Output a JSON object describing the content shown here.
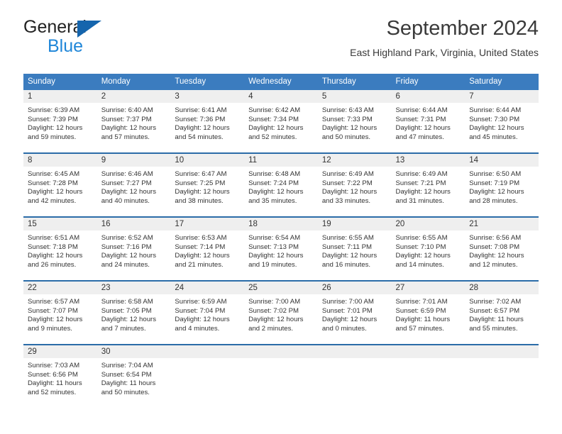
{
  "brand": {
    "line1": "General",
    "line2": "Blue",
    "triangle_color": "#1565ad",
    "blue_text_color": "#1f86d8"
  },
  "header": {
    "title": "September 2024",
    "subtitle": "East Highland Park, Virginia, United States"
  },
  "colors": {
    "header_band": "#3b7cbf",
    "row_divider": "#2b6ca8",
    "daynum_band": "#efefef",
    "text": "#333333"
  },
  "weekday_headers": [
    "Sunday",
    "Monday",
    "Tuesday",
    "Wednesday",
    "Thursday",
    "Friday",
    "Saturday"
  ],
  "weeks": [
    [
      {
        "day": "1",
        "sunrise": "Sunrise: 6:39 AM",
        "sunset": "Sunset: 7:39 PM",
        "daylight1": "Daylight: 12 hours",
        "daylight2": "and 59 minutes."
      },
      {
        "day": "2",
        "sunrise": "Sunrise: 6:40 AM",
        "sunset": "Sunset: 7:37 PM",
        "daylight1": "Daylight: 12 hours",
        "daylight2": "and 57 minutes."
      },
      {
        "day": "3",
        "sunrise": "Sunrise: 6:41 AM",
        "sunset": "Sunset: 7:36 PM",
        "daylight1": "Daylight: 12 hours",
        "daylight2": "and 54 minutes."
      },
      {
        "day": "4",
        "sunrise": "Sunrise: 6:42 AM",
        "sunset": "Sunset: 7:34 PM",
        "daylight1": "Daylight: 12 hours",
        "daylight2": "and 52 minutes."
      },
      {
        "day": "5",
        "sunrise": "Sunrise: 6:43 AM",
        "sunset": "Sunset: 7:33 PM",
        "daylight1": "Daylight: 12 hours",
        "daylight2": "and 50 minutes."
      },
      {
        "day": "6",
        "sunrise": "Sunrise: 6:44 AM",
        "sunset": "Sunset: 7:31 PM",
        "daylight1": "Daylight: 12 hours",
        "daylight2": "and 47 minutes."
      },
      {
        "day": "7",
        "sunrise": "Sunrise: 6:44 AM",
        "sunset": "Sunset: 7:30 PM",
        "daylight1": "Daylight: 12 hours",
        "daylight2": "and 45 minutes."
      }
    ],
    [
      {
        "day": "8",
        "sunrise": "Sunrise: 6:45 AM",
        "sunset": "Sunset: 7:28 PM",
        "daylight1": "Daylight: 12 hours",
        "daylight2": "and 42 minutes."
      },
      {
        "day": "9",
        "sunrise": "Sunrise: 6:46 AM",
        "sunset": "Sunset: 7:27 PM",
        "daylight1": "Daylight: 12 hours",
        "daylight2": "and 40 minutes."
      },
      {
        "day": "10",
        "sunrise": "Sunrise: 6:47 AM",
        "sunset": "Sunset: 7:25 PM",
        "daylight1": "Daylight: 12 hours",
        "daylight2": "and 38 minutes."
      },
      {
        "day": "11",
        "sunrise": "Sunrise: 6:48 AM",
        "sunset": "Sunset: 7:24 PM",
        "daylight1": "Daylight: 12 hours",
        "daylight2": "and 35 minutes."
      },
      {
        "day": "12",
        "sunrise": "Sunrise: 6:49 AM",
        "sunset": "Sunset: 7:22 PM",
        "daylight1": "Daylight: 12 hours",
        "daylight2": "and 33 minutes."
      },
      {
        "day": "13",
        "sunrise": "Sunrise: 6:49 AM",
        "sunset": "Sunset: 7:21 PM",
        "daylight1": "Daylight: 12 hours",
        "daylight2": "and 31 minutes."
      },
      {
        "day": "14",
        "sunrise": "Sunrise: 6:50 AM",
        "sunset": "Sunset: 7:19 PM",
        "daylight1": "Daylight: 12 hours",
        "daylight2": "and 28 minutes."
      }
    ],
    [
      {
        "day": "15",
        "sunrise": "Sunrise: 6:51 AM",
        "sunset": "Sunset: 7:18 PM",
        "daylight1": "Daylight: 12 hours",
        "daylight2": "and 26 minutes."
      },
      {
        "day": "16",
        "sunrise": "Sunrise: 6:52 AM",
        "sunset": "Sunset: 7:16 PM",
        "daylight1": "Daylight: 12 hours",
        "daylight2": "and 24 minutes."
      },
      {
        "day": "17",
        "sunrise": "Sunrise: 6:53 AM",
        "sunset": "Sunset: 7:14 PM",
        "daylight1": "Daylight: 12 hours",
        "daylight2": "and 21 minutes."
      },
      {
        "day": "18",
        "sunrise": "Sunrise: 6:54 AM",
        "sunset": "Sunset: 7:13 PM",
        "daylight1": "Daylight: 12 hours",
        "daylight2": "and 19 minutes."
      },
      {
        "day": "19",
        "sunrise": "Sunrise: 6:55 AM",
        "sunset": "Sunset: 7:11 PM",
        "daylight1": "Daylight: 12 hours",
        "daylight2": "and 16 minutes."
      },
      {
        "day": "20",
        "sunrise": "Sunrise: 6:55 AM",
        "sunset": "Sunset: 7:10 PM",
        "daylight1": "Daylight: 12 hours",
        "daylight2": "and 14 minutes."
      },
      {
        "day": "21",
        "sunrise": "Sunrise: 6:56 AM",
        "sunset": "Sunset: 7:08 PM",
        "daylight1": "Daylight: 12 hours",
        "daylight2": "and 12 minutes."
      }
    ],
    [
      {
        "day": "22",
        "sunrise": "Sunrise: 6:57 AM",
        "sunset": "Sunset: 7:07 PM",
        "daylight1": "Daylight: 12 hours",
        "daylight2": "and 9 minutes."
      },
      {
        "day": "23",
        "sunrise": "Sunrise: 6:58 AM",
        "sunset": "Sunset: 7:05 PM",
        "daylight1": "Daylight: 12 hours",
        "daylight2": "and 7 minutes."
      },
      {
        "day": "24",
        "sunrise": "Sunrise: 6:59 AM",
        "sunset": "Sunset: 7:04 PM",
        "daylight1": "Daylight: 12 hours",
        "daylight2": "and 4 minutes."
      },
      {
        "day": "25",
        "sunrise": "Sunrise: 7:00 AM",
        "sunset": "Sunset: 7:02 PM",
        "daylight1": "Daylight: 12 hours",
        "daylight2": "and 2 minutes."
      },
      {
        "day": "26",
        "sunrise": "Sunrise: 7:00 AM",
        "sunset": "Sunset: 7:01 PM",
        "daylight1": "Daylight: 12 hours",
        "daylight2": "and 0 minutes."
      },
      {
        "day": "27",
        "sunrise": "Sunrise: 7:01 AM",
        "sunset": "Sunset: 6:59 PM",
        "daylight1": "Daylight: 11 hours",
        "daylight2": "and 57 minutes."
      },
      {
        "day": "28",
        "sunrise": "Sunrise: 7:02 AM",
        "sunset": "Sunset: 6:57 PM",
        "daylight1": "Daylight: 11 hours",
        "daylight2": "and 55 minutes."
      }
    ],
    [
      {
        "day": "29",
        "sunrise": "Sunrise: 7:03 AM",
        "sunset": "Sunset: 6:56 PM",
        "daylight1": "Daylight: 11 hours",
        "daylight2": "and 52 minutes."
      },
      {
        "day": "30",
        "sunrise": "Sunrise: 7:04 AM",
        "sunset": "Sunset: 6:54 PM",
        "daylight1": "Daylight: 11 hours",
        "daylight2": "and 50 minutes."
      },
      {
        "day": "",
        "sunrise": "",
        "sunset": "",
        "daylight1": "",
        "daylight2": ""
      },
      {
        "day": "",
        "sunrise": "",
        "sunset": "",
        "daylight1": "",
        "daylight2": ""
      },
      {
        "day": "",
        "sunrise": "",
        "sunset": "",
        "daylight1": "",
        "daylight2": ""
      },
      {
        "day": "",
        "sunrise": "",
        "sunset": "",
        "daylight1": "",
        "daylight2": ""
      },
      {
        "day": "",
        "sunrise": "",
        "sunset": "",
        "daylight1": "",
        "daylight2": ""
      }
    ]
  ]
}
